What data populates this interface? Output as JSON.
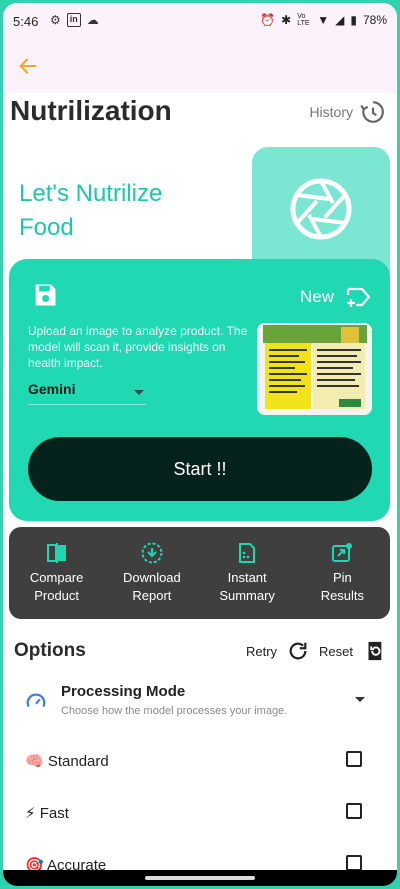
{
  "status_bar": {
    "time": "5:46",
    "battery": "78%",
    "network": "Vo LTE"
  },
  "header": {
    "title": "Nutrilization",
    "history_label": "History"
  },
  "hero": {
    "line1": "Let's Nutrilize",
    "line2": "Food"
  },
  "upload_card": {
    "new_label": "New",
    "description": "Upload an image to analyze product. The model will scan it, provide insights on health impact.",
    "model_selected": "Gemini",
    "start_label": "Start !!"
  },
  "actions": [
    {
      "line1": "Compare",
      "line2": "Product"
    },
    {
      "line1": "Download",
      "line2": "Report"
    },
    {
      "line1": "Instant",
      "line2": "Summary"
    },
    {
      "line1": "Pin",
      "line2": "Results"
    }
  ],
  "options": {
    "title": "Options",
    "retry_label": "Retry",
    "reset_label": "Reset",
    "processing_mode": {
      "title": "Processing Mode",
      "subtitle": "Choose how the model processes your image."
    },
    "items": [
      {
        "emoji": "🧠",
        "label": "Standard",
        "checked": false
      },
      {
        "emoji": "⚡",
        "label": "Fast",
        "checked": false
      },
      {
        "emoji": "🎯",
        "label": "Accurate",
        "checked": false
      }
    ]
  },
  "colors": {
    "accent": "#20d8b2",
    "accent_light": "#7be7d2",
    "dark_button": "#06221c",
    "actions_bar": "#3f3f3f",
    "appbar": "#fbf2fb",
    "back_arrow": "#f5a623"
  }
}
